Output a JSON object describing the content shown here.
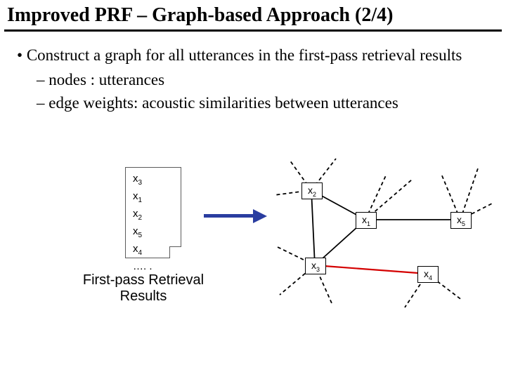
{
  "title": "Improved PRF – Graph-based Approach (2/4)",
  "bullet_main": "Construct a graph for all utterances in the first-pass retrieval results",
  "sub_nodes": "nodes : utterances",
  "sub_edges": "edge weights: acoustic similarities between utterances",
  "doc": {
    "l1": "x",
    "s1": "3",
    "l2": "x",
    "s2": "1",
    "l3": "x",
    "s3": "2",
    "l4": "x",
    "s4": "5",
    "l5": "x",
    "s5": "4",
    "l6": "…. ."
  },
  "caption": "First-pass Retrieval Results",
  "nodes": {
    "n1": "x",
    "n1s": "1",
    "n2": "x",
    "n2s": "2",
    "n3": "x",
    "n3s": "3",
    "n4": "x",
    "n4s": "4",
    "n5": "x",
    "n5s": "5"
  }
}
